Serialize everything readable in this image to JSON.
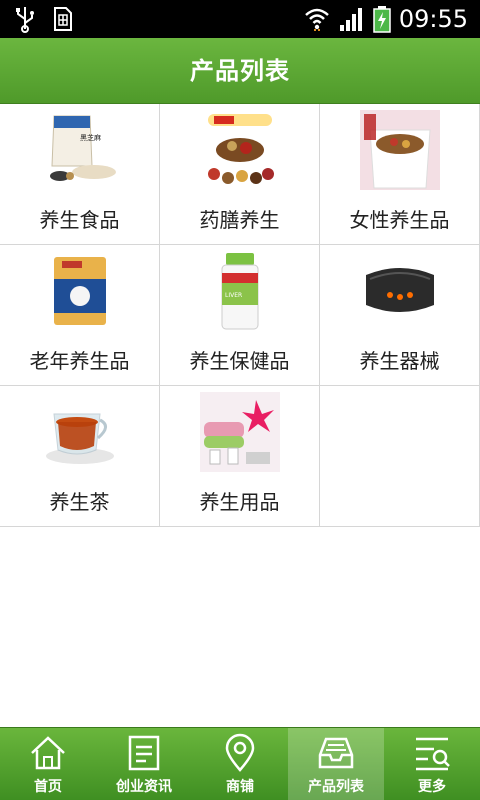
{
  "status_bar": {
    "time": "09:55",
    "icons": [
      "usb-icon",
      "sim-card-icon",
      "wifi-icon",
      "signal-icon",
      "battery-charging-icon"
    ]
  },
  "header": {
    "title": "产品列表"
  },
  "grid": {
    "items": [
      {
        "label": "养生食品",
        "icon": "food-product-image"
      },
      {
        "label": "药膳养生",
        "icon": "herbal-cuisine-image"
      },
      {
        "label": "女性养生品",
        "icon": "womens-health-image"
      },
      {
        "label": "老年养生品",
        "icon": "elderly-health-image"
      },
      {
        "label": "养生保健品",
        "icon": "supplement-bottle-image"
      },
      {
        "label": "养生器械",
        "icon": "waist-belt-image"
      },
      {
        "label": "养生茶",
        "icon": "tea-cup-image"
      },
      {
        "label": "养生用品",
        "icon": "spa-products-image"
      }
    ]
  },
  "tabbar": {
    "tabs": [
      {
        "label": "首页",
        "icon": "home-icon"
      },
      {
        "label": "创业资讯",
        "icon": "document-icon"
      },
      {
        "label": "商铺",
        "icon": "location-pin-icon"
      },
      {
        "label": "产品列表",
        "icon": "inbox-tray-icon",
        "active": true
      },
      {
        "label": "更多",
        "icon": "menu-search-icon"
      }
    ]
  },
  "colors": {
    "brand_green": "#5aa832",
    "status_bar": "#000000",
    "divider": "#d6d6d6"
  }
}
